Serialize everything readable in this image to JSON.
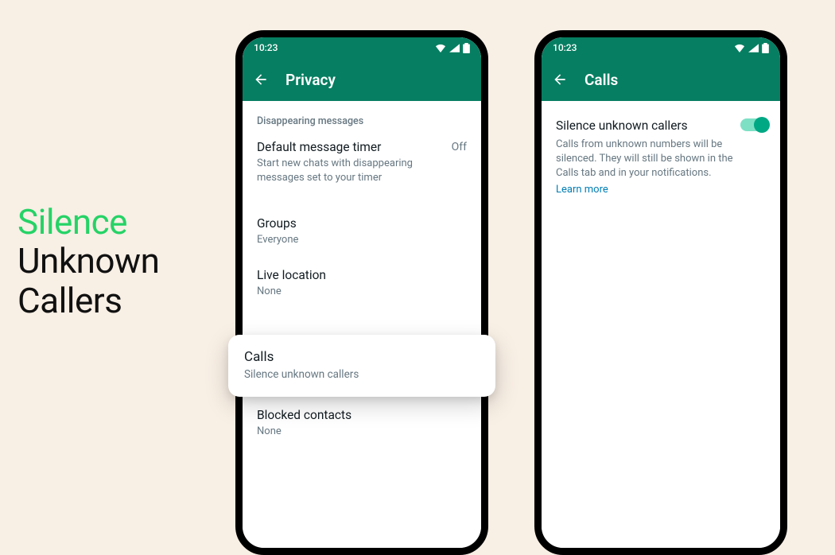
{
  "headline": {
    "line1": "Silence",
    "line2": "Unknown",
    "line3": "Callers"
  },
  "status": {
    "time": "10:23"
  },
  "phone1": {
    "title": "Privacy",
    "sectionHeader": "Disappearing messages",
    "timer": {
      "title": "Default message timer",
      "sub": "Start new chats with disappearing messages set to your timer",
      "value": "Off"
    },
    "groups": {
      "title": "Groups",
      "sub": "Everyone"
    },
    "liveLocation": {
      "title": "Live location",
      "sub": "None"
    },
    "calls": {
      "title": "Calls",
      "sub": "Silence unknown callers"
    },
    "blocked": {
      "title": "Blocked contacts",
      "sub": "None"
    }
  },
  "phone2": {
    "title": "Calls",
    "item": {
      "title": "Silence unknown callers",
      "desc": "Calls from unknown numbers will be silenced. They will still be shown in the Calls tab and in your notifications.",
      "learnMore": "Learn more"
    }
  }
}
